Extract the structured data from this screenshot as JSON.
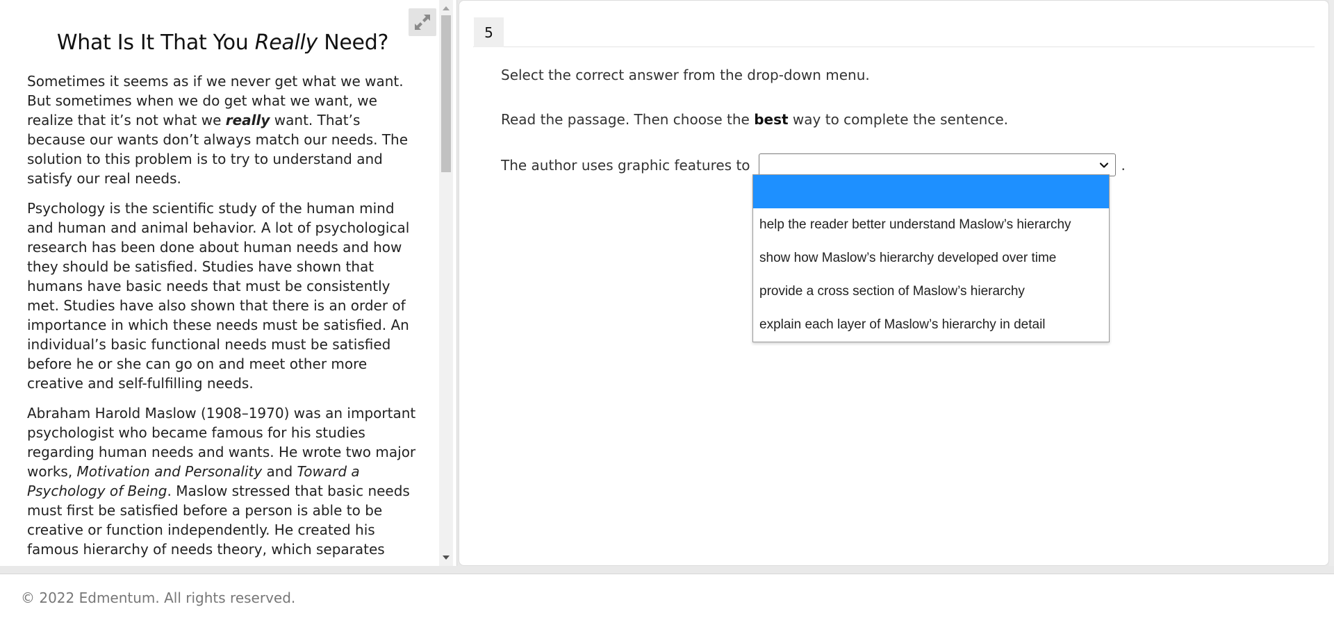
{
  "passage": {
    "title_before": "What Is It That You ",
    "title_italic": "Really",
    "title_after": " Need?",
    "paragraph1_a": "Sometimes it seems as if we never get what we want. But sometimes when we do get what we want, we realize that it’s not what we ",
    "paragraph1_em": "really",
    "paragraph1_b": " want. That’s because our wants don’t always match our needs. The solution to this problem is to try to understand and satisfy our real needs.",
    "paragraph2": "Psychology is the scientific study of the human mind and human and animal behavior. A lot of psychological research has been done about human needs and how they should be satisfied. Studies have shown that humans have basic needs that must be consistently met. Studies have also shown that there is an order of importance in which these needs must be satisfied. An individual’s basic functional needs must be satisfied before he or she can go on and meet other more creative and self-fulfilling needs.",
    "paragraph3_a": "Abraham Harold Maslow (1908–1970) was an important psychologist who became famous for his studies regarding human needs and wants. He wrote two major works, ",
    "paragraph3_work1": "Motivation and Personality",
    "paragraph3_and": " and ",
    "paragraph3_work2": "Toward a Psychology of Being",
    "paragraph3_b": ". Maslow stressed that basic needs must first be satisfied before a person is able to be creative or function independently. He created his famous hierarchy of needs theory, which separates"
  },
  "question": {
    "number": "5",
    "instruction1": "Select the correct answer from the drop-down menu.",
    "instruction2_before": "Read the passage. Then choose the ",
    "instruction2_bold": "best",
    "instruction2_after": " way to complete the sentence.",
    "sentence_prefix": "The author uses graphic features to",
    "sentence_suffix": ".",
    "select_value": "",
    "options": [
      "",
      "help the reader better understand Maslow’s hierarchy",
      "show how Maslow’s hierarchy developed over time",
      "provide a cross section of Maslow’s hierarchy",
      "explain each layer of Maslow’s hierarchy in detail"
    ]
  },
  "footer": {
    "copyright": "© 2022 Edmentum. All rights reserved."
  },
  "colors": {
    "highlight": "#1e90ff",
    "footer_text": "#777777"
  }
}
